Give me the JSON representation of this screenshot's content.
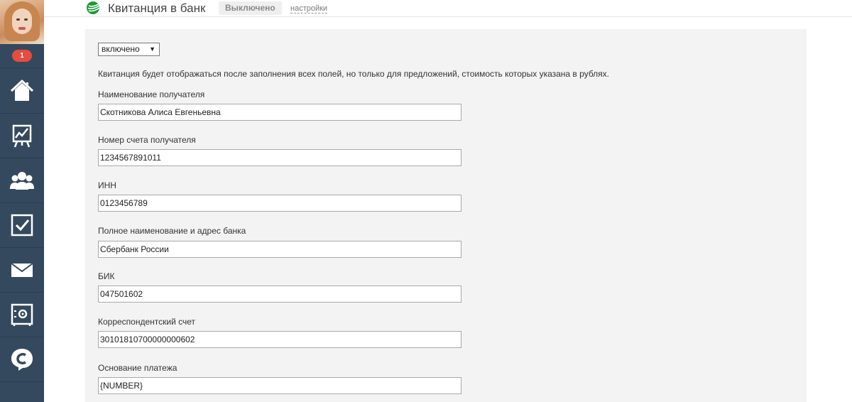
{
  "header": {
    "title": "Квитанция в банк",
    "status": "Выключено",
    "settings_link": "настройки"
  },
  "sidebar": {
    "notification_count": "1",
    "items": [
      {
        "name": "home",
        "icon": "home-icon"
      },
      {
        "name": "analytics",
        "icon": "chart-board-icon"
      },
      {
        "name": "clients",
        "icon": "users-group-icon"
      },
      {
        "name": "tasks",
        "icon": "checkbox-icon"
      },
      {
        "name": "mail",
        "icon": "envelope-icon"
      },
      {
        "name": "safe",
        "icon": "safe-icon"
      },
      {
        "name": "chat",
        "icon": "chat-c-icon"
      }
    ]
  },
  "form": {
    "toggle_select": {
      "value": "включено"
    },
    "note": "Квитанция будет отображаться после заполнения всех полей, но только для предложений, стоимость которых указана в рублях.",
    "fields": [
      {
        "label": "Наименование получателя",
        "value": "Скотникова Алиса Евгеньевна"
      },
      {
        "label": "Номер счета получателя",
        "value": "1234567891011"
      },
      {
        "label": "ИНН",
        "value": "0123456789"
      },
      {
        "label": "Полное наименование и адрес банка",
        "value": "Сбербанк России"
      },
      {
        "label": "БИК",
        "value": "047501602"
      },
      {
        "label": "Корреспондентский счет",
        "value": "30101810700000000602"
      },
      {
        "label": "Основание платежа",
        "value": "{NUMBER}"
      }
    ]
  },
  "colors": {
    "sidebar_bg": "#34495e",
    "badge": "#e74c3c",
    "panel_bg": "#f3f3f3",
    "brand_green": "#1e9a3a"
  }
}
